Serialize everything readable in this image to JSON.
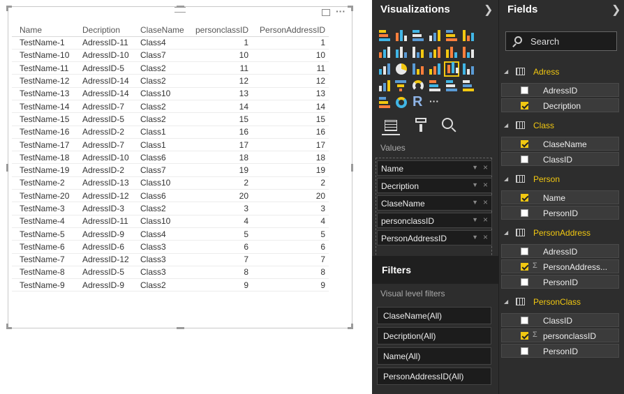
{
  "table": {
    "columns": [
      "Name",
      "Decription",
      "ClaseName",
      "personclassID",
      "PersonAddressID"
    ],
    "rows": [
      [
        "TestName-1",
        "AdressID-11",
        "Class4",
        "1",
        "1"
      ],
      [
        "TestName-10",
        "AdressID-10",
        "Class7",
        "10",
        "10"
      ],
      [
        "TestName-11",
        "AdressID-5",
        "Class2",
        "11",
        "11"
      ],
      [
        "TestName-12",
        "AdressID-14",
        "Class2",
        "12",
        "12"
      ],
      [
        "TestName-13",
        "AdressID-14",
        "Class10",
        "13",
        "13"
      ],
      [
        "TestName-14",
        "AdressID-7",
        "Class2",
        "14",
        "14"
      ],
      [
        "TestName-15",
        "AdressID-5",
        "Class2",
        "15",
        "15"
      ],
      [
        "TestName-16",
        "AdressID-2",
        "Class1",
        "16",
        "16"
      ],
      [
        "TestName-17",
        "AdressID-7",
        "Class1",
        "17",
        "17"
      ],
      [
        "TestName-18",
        "AdressID-10",
        "Class6",
        "18",
        "18"
      ],
      [
        "TestName-19",
        "AdressID-2",
        "Class7",
        "19",
        "19"
      ],
      [
        "TestName-2",
        "AdressID-13",
        "Class10",
        "2",
        "2"
      ],
      [
        "TestName-20",
        "AdressID-12",
        "Class6",
        "20",
        "20"
      ],
      [
        "TestName-3",
        "AdressID-3",
        "Class2",
        "3",
        "3"
      ],
      [
        "TestName-4",
        "AdressID-11",
        "Class10",
        "4",
        "4"
      ],
      [
        "TestName-5",
        "AdressID-9",
        "Class4",
        "5",
        "5"
      ],
      [
        "TestName-6",
        "AdressID-6",
        "Class3",
        "6",
        "6"
      ],
      [
        "TestName-7",
        "AdressID-12",
        "Class3",
        "7",
        "7"
      ],
      [
        "TestName-8",
        "AdressID-5",
        "Class3",
        "8",
        "8"
      ],
      [
        "TestName-9",
        "AdressID-9",
        "Class2",
        "9",
        "9"
      ]
    ]
  },
  "visual_header": {
    "focus_icon": "focus-mode-icon",
    "more_icon": "more-options-icon",
    "more_glyph": "···"
  },
  "visualizations": {
    "title": "Visualizations",
    "r_label": "R",
    "more_glyph": "···",
    "values_label": "Values",
    "values": [
      "Name",
      "Decription",
      "ClaseName",
      "personclassID",
      "PersonAddressID"
    ]
  },
  "filters": {
    "title": "Filters",
    "visual_level_label": "Visual level filters",
    "items": [
      "ClaseName(All)",
      "Decription(All)",
      "Name(All)",
      "PersonAddressID(All)"
    ]
  },
  "fields": {
    "title": "Fields",
    "search_placeholder": "Search",
    "tables": [
      {
        "name": "Adress",
        "fields": [
          {
            "name": "AdressID",
            "checked": false,
            "sigma": false
          },
          {
            "name": "Decription",
            "checked": true,
            "sigma": false
          }
        ]
      },
      {
        "name": "Class",
        "fields": [
          {
            "name": "ClaseName",
            "checked": true,
            "sigma": false
          },
          {
            "name": "ClassID",
            "checked": false,
            "sigma": false
          }
        ]
      },
      {
        "name": "Person",
        "fields": [
          {
            "name": "Name",
            "checked": true,
            "sigma": false
          },
          {
            "name": "PersonID",
            "checked": false,
            "sigma": false
          }
        ]
      },
      {
        "name": "PersonAddress",
        "fields": [
          {
            "name": "AdressID",
            "checked": false,
            "sigma": false
          },
          {
            "name": "PersonAddress...",
            "checked": true,
            "sigma": true
          },
          {
            "name": "PersonID",
            "checked": false,
            "sigma": false
          }
        ]
      },
      {
        "name": "PersonClass",
        "fields": [
          {
            "name": "ClassID",
            "checked": false,
            "sigma": false
          },
          {
            "name": "personclassID",
            "checked": true,
            "sigma": true
          },
          {
            "name": "PersonID",
            "checked": false,
            "sigma": false
          }
        ]
      }
    ]
  },
  "colors": {
    "accent": "#f2c811",
    "pane_bg": "#2d2d2d"
  }
}
